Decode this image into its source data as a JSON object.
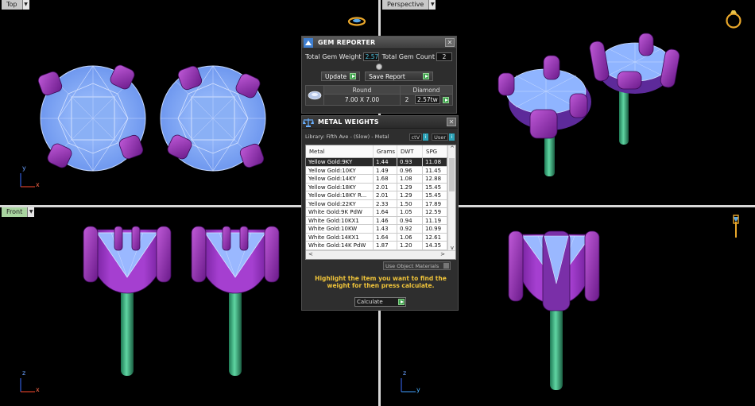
{
  "viewports": {
    "top": {
      "label": "Top"
    },
    "perspective": {
      "label": "Perspective"
    },
    "front": {
      "label": "Front"
    },
    "right": {
      "label": ""
    }
  },
  "axes": {
    "top": {
      "v": "y",
      "h": "x"
    },
    "front": {
      "v": "z",
      "h": "x"
    },
    "right": {
      "v": "z",
      "h": "y"
    }
  },
  "gem_reporter": {
    "title": "GEM REPORTER",
    "total_weight_label": "Total Gem Weight",
    "total_weight_value": "2.57",
    "total_count_label": "Total Gem Count",
    "total_count_value": "2",
    "update_label": "Update",
    "save_label": "Save Report",
    "table": {
      "shape_header": "Round",
      "shape_value": "7.00 X 7.00",
      "type_header": "Diamond",
      "count_value": "2",
      "weight_value": "2.57tw"
    }
  },
  "metal_weights": {
    "title": "METAL WEIGHTS",
    "library": "Library: Fifth Ave - (Slow) - Metal",
    "toggle1_label": "ctV",
    "toggle2_label": "User",
    "columns": [
      "Metal",
      "Grams",
      "DWT",
      "SPG"
    ],
    "rows": [
      [
        "Yellow Gold:9KY",
        "1.44",
        "0.93",
        "11.08"
      ],
      [
        "Yellow Gold:10KY",
        "1.49",
        "0.96",
        "11.45"
      ],
      [
        "Yellow Gold:14KY",
        "1.68",
        "1.08",
        "12.88"
      ],
      [
        "Yellow Gold:18KY",
        "2.01",
        "1.29",
        "15.45"
      ],
      [
        "Yellow Gold:18KY R...",
        "2.01",
        "1.29",
        "15.45"
      ],
      [
        "Yellow Gold:22KY",
        "2.33",
        "1.50",
        "17.89"
      ],
      [
        "White Gold:9K PdW",
        "1.64",
        "1.05",
        "12.59"
      ],
      [
        "White Gold:10KX1",
        "1.46",
        "0.94",
        "11.19"
      ],
      [
        "White Gold:10KW",
        "1.43",
        "0.92",
        "10.99"
      ],
      [
        "White Gold:14KX1",
        "1.64",
        "1.06",
        "12.61"
      ],
      [
        "White Gold:14K PdW",
        "1.87",
        "1.20",
        "14.35"
      ]
    ],
    "use_object_materials": "Use Object Materials",
    "hint": "Highlight the item you want to find the weight for then press calculate.",
    "calculate_label": "Calculate"
  }
}
